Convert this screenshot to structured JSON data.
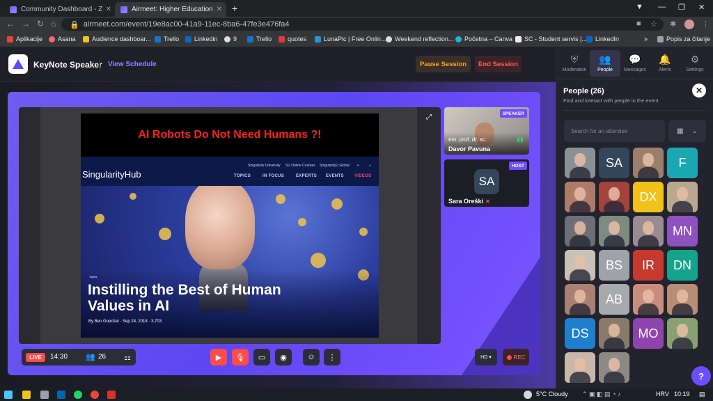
{
  "browser": {
    "tabs": [
      {
        "label": "Community Dashboard - Zsemak",
        "active": false
      },
      {
        "label": "Airmeet: Higher Education In",
        "active": true
      }
    ],
    "url": "airmeet.com/event/19e8ac00-41a9-11ec-8ba6-47fe3e476fa4",
    "bookmarks": [
      "Aplikacije",
      "Asana",
      "Audience dashboar...",
      "Trello",
      "Linkedin",
      "9",
      "Trello",
      "quotes",
      "LunaPic | Free Onlin...",
      "Weekend reflection...",
      "Početna – Canva",
      "SC - Student servis |...",
      "LinkedIn"
    ],
    "bookmarks_overflow": "»",
    "reading_list": "Popis za čitanje"
  },
  "header": {
    "session_title": "KeyNote Speaker",
    "view_schedule": "View Schedule",
    "pause_label": "Pause Session",
    "end_label": "End Session"
  },
  "slide": {
    "headline": "AI  Robots Do Not Need Humans ?!",
    "site_logo": "SingularityHub",
    "sub_links": [
      "Singularity University",
      "SU Online Courses",
      "SingularityU Global"
    ],
    "menu": [
      "TOPICS",
      "IN FOCUS",
      "EXPERTS",
      "EVENTS",
      "VIDEOS"
    ],
    "tag": "Topics",
    "title": "Instilling the Best of Human Values in AI",
    "byline": "By Ben Goertzel · Sep 24, 2018 · 3,703"
  },
  "participants": {
    "speaker": {
      "badge": "SPEAKER",
      "subtitle": "em. prof. dr. sc.",
      "name": "Davor Pavuna"
    },
    "host": {
      "badge": "HOST",
      "initials": "SA",
      "name": "Sara Oreški"
    }
  },
  "controls": {
    "live": "LIVE",
    "time": "14:30",
    "viewers": "26",
    "hd": "HD",
    "rec": "REC"
  },
  "panel": {
    "tabs": [
      {
        "label": "Moderation",
        "icon": "shield-icon"
      },
      {
        "label": "People",
        "icon": "people-icon"
      },
      {
        "label": "Messages",
        "icon": "chat-icon"
      },
      {
        "label": "Alerts",
        "icon": "bell-icon"
      },
      {
        "label": "Settings",
        "icon": "gear-icon"
      }
    ],
    "title": "People (26)",
    "subtitle": "Find and interact with people in the event",
    "search_placeholder": "Search for an attendee",
    "attendees": [
      {
        "initials": "",
        "color": "#8b8f96"
      },
      {
        "initials": "SA",
        "color": "#33465a"
      },
      {
        "initials": "",
        "color": "#9a7f6a"
      },
      {
        "initials": "F",
        "color": "#1aa7b3"
      },
      {
        "initials": "",
        "color": "#b07a6a"
      },
      {
        "initials": "",
        "color": "#a2443c"
      },
      {
        "initials": "DX",
        "color": "#f2c21b"
      },
      {
        "initials": "",
        "color": "#b8a88f"
      },
      {
        "initials": "",
        "color": "#6c6f75"
      },
      {
        "initials": "",
        "color": "#7f8a80"
      },
      {
        "initials": "",
        "color": "#9b8b93"
      },
      {
        "initials": "MN",
        "color": "#8e52c0"
      },
      {
        "initials": "",
        "color": "#c9c1b6"
      },
      {
        "initials": "BS",
        "color": "#9ea3a9"
      },
      {
        "initials": "IR",
        "color": "#c6392f"
      },
      {
        "initials": "DN",
        "color": "#14a38c"
      },
      {
        "initials": "",
        "color": "#a98072"
      },
      {
        "initials": "AB",
        "color": "#a8a9ad"
      },
      {
        "initials": "",
        "color": "#c98d7e"
      },
      {
        "initials": "",
        "color": "#b78e75"
      },
      {
        "initials": "DS",
        "color": "#1f7fcf"
      },
      {
        "initials": "",
        "color": "#8a7a6c"
      },
      {
        "initials": "MO",
        "color": "#8e44ad"
      },
      {
        "initials": "",
        "color": "#8aa072"
      },
      {
        "initials": "",
        "color": "#c9b8aa"
      },
      {
        "initials": "",
        "color": "#8d8a86"
      }
    ]
  },
  "taskbar": {
    "weather": "5°C  Cloudy",
    "lang": "HRV",
    "time": "10:19"
  }
}
